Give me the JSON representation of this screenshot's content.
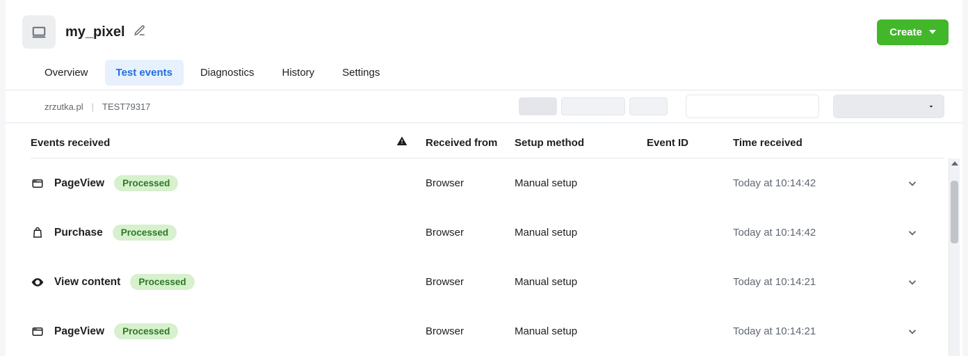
{
  "header": {
    "title": "my_pixel",
    "create_label": "Create"
  },
  "tabs": [
    {
      "label": "Overview",
      "active": false
    },
    {
      "label": "Test events",
      "active": true
    },
    {
      "label": "Diagnostics",
      "active": false
    },
    {
      "label": "History",
      "active": false
    },
    {
      "label": "Settings",
      "active": false
    }
  ],
  "breadcrumb": {
    "domain": "zrzutka.pl",
    "test_id": "TEST79317"
  },
  "table": {
    "columns": {
      "events": "Events received",
      "received_from": "Received from",
      "setup_method": "Setup method",
      "event_id": "Event ID",
      "time_received": "Time received"
    },
    "rows": [
      {
        "icon": "window",
        "name": "PageView",
        "status": "Processed",
        "received_from": "Browser",
        "setup_method": "Manual setup",
        "event_id": "",
        "time": "Today at 10:14:42"
      },
      {
        "icon": "bag",
        "name": "Purchase",
        "status": "Processed",
        "received_from": "Browser",
        "setup_method": "Manual setup",
        "event_id": "",
        "time": "Today at 10:14:42"
      },
      {
        "icon": "eye",
        "name": "View content",
        "status": "Processed",
        "received_from": "Browser",
        "setup_method": "Manual setup",
        "event_id": "",
        "time": "Today at 10:14:21"
      },
      {
        "icon": "window",
        "name": "PageView",
        "status": "Processed",
        "received_from": "Browser",
        "setup_method": "Manual setup",
        "event_id": "",
        "time": "Today at 10:14:21"
      }
    ]
  }
}
